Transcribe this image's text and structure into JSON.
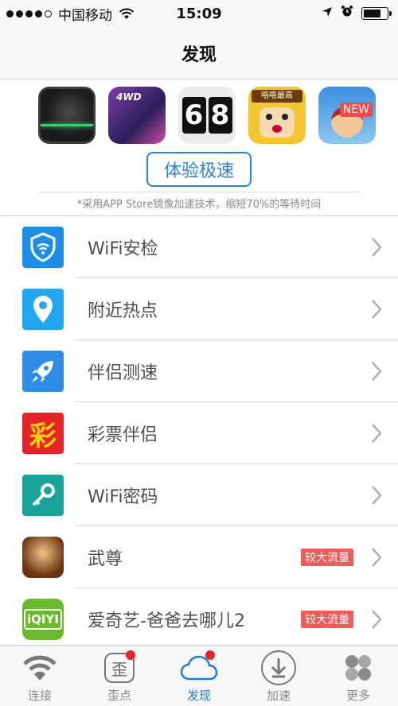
{
  "status_bar": {
    "carrier": "中国移动",
    "time": "15:09",
    "battery_level": 0.75
  },
  "nav": {
    "title": "发现"
  },
  "banner": {
    "games": [
      {
        "icon": "game-scanner-icon"
      },
      {
        "icon": "game-4wd-car-icon"
      },
      {
        "icon": "game-68-countdown-icon",
        "digits": [
          "6",
          "8"
        ]
      },
      {
        "icon": "game-funny-face-icon",
        "caption": "咯咯最高"
      },
      {
        "icon": "game-cartoon-kid-icon",
        "badge": "NEW"
      }
    ],
    "button_label": "体验极速",
    "note": "*采用APP Store镜像加速技术，缩短70%的等待时间"
  },
  "list": [
    {
      "label": "WiFi安检",
      "icon": "wifi-shield-icon"
    },
    {
      "label": "附近热点",
      "icon": "location-pin-icon"
    },
    {
      "label": "伴侣测速",
      "icon": "rocket-icon"
    },
    {
      "label": "彩票伴侣",
      "icon": "lottery-icon",
      "icon_text": "彩"
    },
    {
      "label": "WiFi密码",
      "icon": "key-icon"
    },
    {
      "label": "武尊",
      "icon": "wuzun-game-icon",
      "tag": "较大流量"
    },
    {
      "label": "爱奇艺-爸爸去哪儿2",
      "icon": "iqiyi-icon",
      "icon_text": "iQIYI",
      "tag": "较大流量"
    }
  ],
  "tabs": [
    {
      "label": "连接",
      "icon": "wifi-icon"
    },
    {
      "label": "歪点",
      "icon": "wai-icon",
      "icon_text": "歪"
    },
    {
      "label": "发现",
      "icon": "cloud-icon"
    },
    {
      "label": "加速",
      "icon": "download-icon"
    },
    {
      "label": "更多",
      "icon": "more-icon"
    }
  ],
  "colors": {
    "accent": "#1b7fd6",
    "tag_red": "#ef5a5a",
    "badge_red": "#e5242a"
  }
}
